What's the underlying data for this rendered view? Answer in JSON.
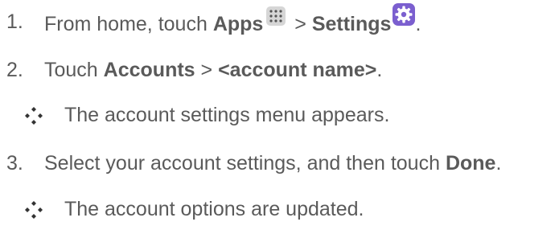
{
  "steps": [
    {
      "number": "1.",
      "prefix": "From home, touch ",
      "bold1": "Apps",
      "mid": " > ",
      "bold2": "Settings",
      "suffix": "."
    },
    {
      "number": "2.",
      "prefix": "Touch ",
      "bold1": "Accounts",
      "mid": " > ",
      "bold2": "<account name>",
      "suffix": "."
    },
    {
      "bullet": "The account settings menu appears."
    },
    {
      "number": "3.",
      "prefix": "Select your account settings, and then touch ",
      "bold1": "Done",
      "suffix": "."
    },
    {
      "bullet": "The account options are updated."
    }
  ],
  "icons": {
    "apps": "apps-grid-icon",
    "settings": "settings-gear-icon",
    "bullet": "diamond-bullet-icon"
  },
  "colors": {
    "text": "#5a5a5a",
    "settings_icon_bg": "#7b5fcf",
    "apps_icon_bg": "#d6d6d6"
  }
}
